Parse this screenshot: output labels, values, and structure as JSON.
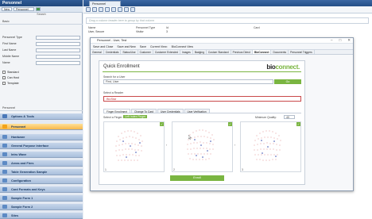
{
  "sidebar": {
    "title": "Personnel",
    "toolbar": {
      "new_label": "New",
      "scope": "Personnel"
    },
    "search_label": "Search",
    "section_basic": "Basic",
    "fields": [
      {
        "label": "Personnel Type"
      },
      {
        "label": "First Name"
      },
      {
        "label": "Last Name"
      },
      {
        "label": "Middle Name"
      },
      {
        "label": "Name"
      }
    ],
    "checkboxes": [
      {
        "label": "Standard"
      },
      {
        "label": "Can Host"
      },
      {
        "label": "Template"
      }
    ],
    "section_personnel": "Personnel",
    "nav": [
      {
        "label": "Options & Tools",
        "color": "#4a78b8",
        "selected": false
      },
      {
        "label": "Personnel",
        "color": "#f2a31b",
        "selected": true
      },
      {
        "label": "Hardware",
        "color": "#5d8ac4",
        "selected": false
      },
      {
        "label": "General Purpose Interface",
        "color": "#5d8ac4",
        "selected": false
      },
      {
        "label": "Intru Wave",
        "color": "#5d8ac4",
        "selected": false
      },
      {
        "label": "Areas and Fires",
        "color": "#5d8ac4",
        "selected": false
      },
      {
        "label": "Table Generation Sample",
        "color": "#5d8ac4",
        "selected": false
      },
      {
        "label": "Configuration",
        "color": "#5d8ac4",
        "selected": false
      },
      {
        "label": "Card Formats and Keys",
        "color": "#5d8ac4",
        "selected": false
      },
      {
        "label": "Sample Form 1",
        "color": "#5d8ac4",
        "selected": false
      },
      {
        "label": "Sample Form 2",
        "color": "#5d8ac4",
        "selected": false
      },
      {
        "label": "Sites",
        "color": "#5d8ac4",
        "selected": false
      }
    ]
  },
  "main": {
    "tab_label": "Personnel",
    "hint": "Drag a column header here to group by that column",
    "columns": [
      "Name",
      "Personnel Type",
      "Id",
      "Card"
    ],
    "row": [
      "User, Secure",
      "Visitor",
      "3",
      ""
    ]
  },
  "dialog": {
    "title": "Personnel - User, Test",
    "toolbar": {
      "save_close": "Save and Close",
      "save_new": "Save and New",
      "save": "Save",
      "current_view": "Current View:",
      "view_value": "BioConnect View"
    },
    "tabs": [
      "General",
      "Credentials",
      "Status/Use",
      "Customer",
      "Customer Extended",
      "Images",
      "Badging",
      "Custom Standard",
      "Previous Direct",
      "BioConnect",
      "Documents",
      "Personnel Triggers"
    ],
    "selected_tab": "BioConnect",
    "controls": {
      "minimize": "–",
      "maximize": "□",
      "close": "✕"
    }
  },
  "enrollment": {
    "heading": "Quick Enrollment",
    "brand_main": "bio",
    "brand_accent": "connect.",
    "search_label": "Search for a User",
    "search_value": "First, User",
    "go_label": "Go",
    "reader_label": "Select a Reader",
    "reader_value": "BioStar",
    "tabs": [
      "Finger Enrollment",
      "Change To Card",
      "User Credentials",
      "User Verification"
    ],
    "select_finger_label": "Select a Finger:",
    "selected_finger": "Left Index Finger",
    "min_quality_label": "Minimum Quality:",
    "min_quality_value": "40",
    "panel_numbers": [
      "1",
      "2",
      "3"
    ],
    "enroll_label": "Enroll"
  }
}
